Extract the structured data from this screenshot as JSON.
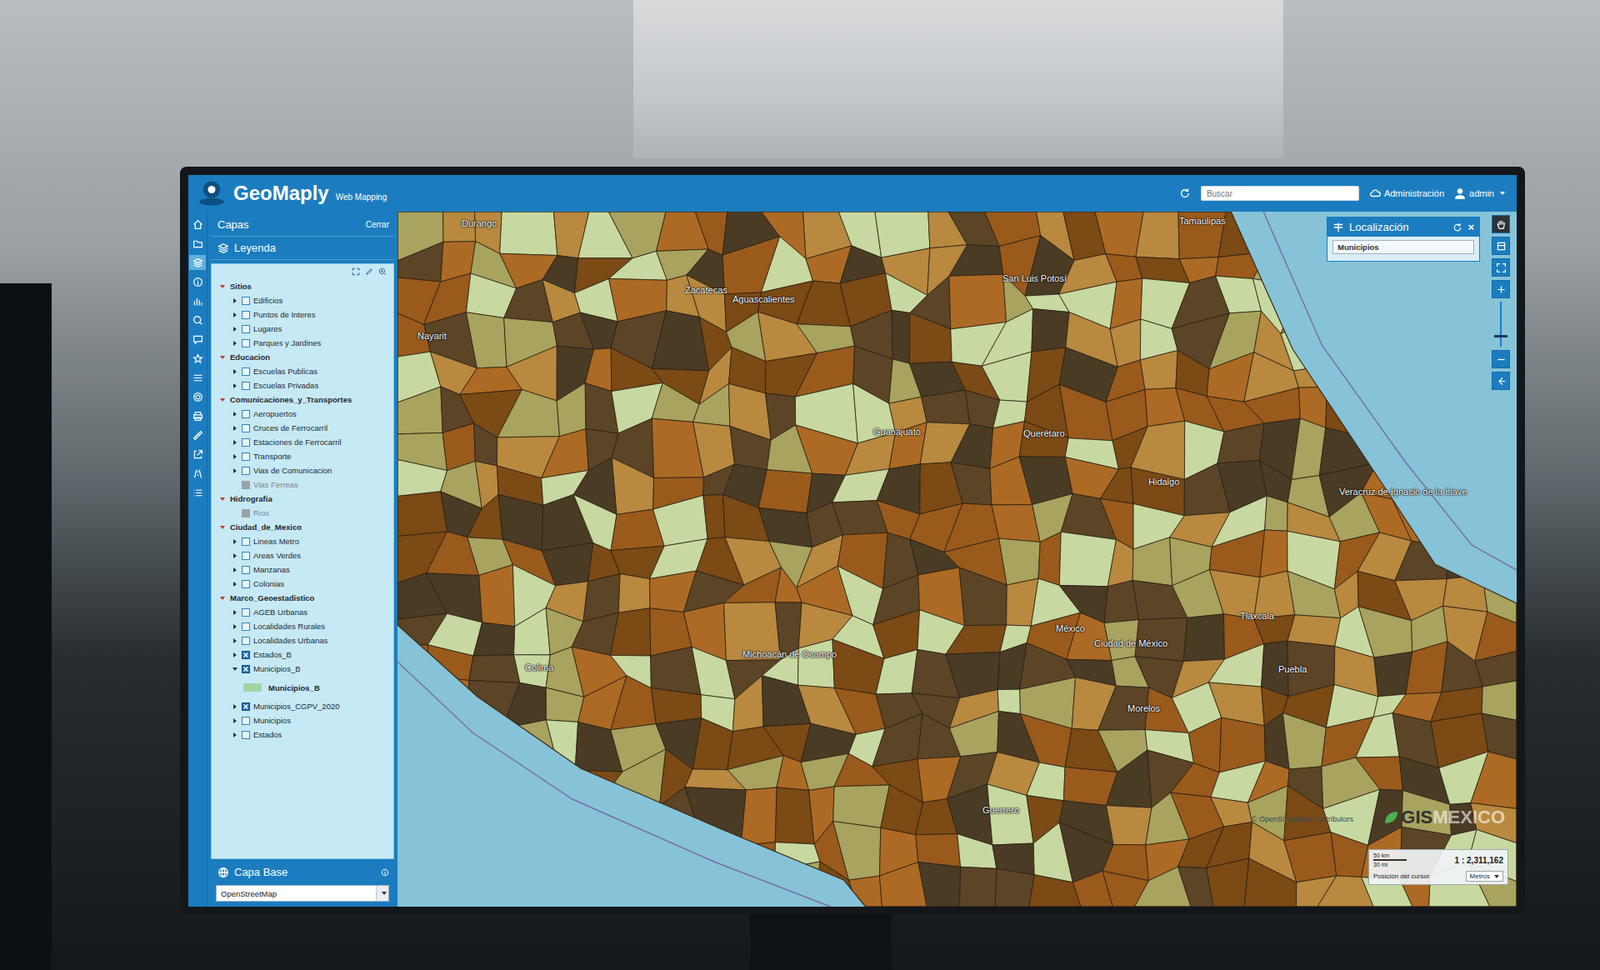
{
  "app": {
    "title": "GeoMaply",
    "subtitle": "Web Mapping"
  },
  "header": {
    "search_placeholder": "Buscar",
    "admin_link": "Administración",
    "user": "admin"
  },
  "rail": [
    {
      "selected": false
    },
    {
      "selected": false
    },
    {
      "selected": true
    },
    {
      "selected": false
    },
    {
      "selected": false
    },
    {
      "selected": false
    },
    {
      "selected": false
    },
    {
      "selected": false
    },
    {
      "selected": false
    },
    {
      "selected": false
    },
    {
      "selected": false
    },
    {
      "selected": false
    },
    {
      "selected": false
    },
    {
      "selected": false
    },
    {
      "selected": false
    }
  ],
  "sidebar": {
    "title": "Capas",
    "close": "Cerrar",
    "tab": "Leyenda",
    "groups": [
      {
        "label": "Sitios",
        "expanded": true,
        "items": [
          {
            "label": "Edificios",
            "checked": false,
            "expanded": false,
            "disabled": false
          },
          {
            "label": "Puntos de Interes",
            "checked": false,
            "expanded": false,
            "disabled": false
          },
          {
            "label": "Lugares",
            "checked": false,
            "expanded": false,
            "disabled": false
          },
          {
            "label": "Parques y Jardines",
            "checked": false,
            "expanded": false,
            "disabled": false
          }
        ]
      },
      {
        "label": "Educacion",
        "expanded": true,
        "items": [
          {
            "label": "Escuelas Publicas",
            "checked": false,
            "expanded": false,
            "disabled": false
          },
          {
            "label": "Escuelas Privadas",
            "checked": false,
            "expanded": false,
            "disabled": false
          }
        ]
      },
      {
        "label": "Comunicaciones_y_Transportes",
        "expanded": true,
        "items": [
          {
            "label": "Aeropuertos",
            "checked": false,
            "expanded": false,
            "disabled": false
          },
          {
            "label": "Cruces de Ferrocarril",
            "checked": false,
            "expanded": false,
            "disabled": false
          },
          {
            "label": "Estaciones de Ferrocarril",
            "checked": false,
            "expanded": false,
            "disabled": false
          },
          {
            "label": "Transporte",
            "checked": false,
            "expanded": false,
            "disabled": false
          },
          {
            "label": "Vias de Comunicacion",
            "checked": false,
            "expanded": false,
            "disabled": false
          },
          {
            "label": "Vias Ferreas",
            "checked": false,
            "expanded": false,
            "disabled": true
          }
        ]
      },
      {
        "label": "Hidrografia",
        "expanded": true,
        "items": [
          {
            "label": "Rios",
            "checked": false,
            "expanded": false,
            "disabled": true
          }
        ]
      },
      {
        "label": "Ciudad_de_Mexico",
        "expanded": true,
        "items": [
          {
            "label": "Lineas Metro",
            "checked": false,
            "expanded": false,
            "disabled": false
          },
          {
            "label": "Areas Verdes",
            "checked": false,
            "expanded": false,
            "disabled": false
          },
          {
            "label": "Manzanas",
            "checked": false,
            "expanded": false,
            "disabled": false
          },
          {
            "label": "Colonias",
            "checked": false,
            "expanded": false,
            "disabled": false
          }
        ]
      },
      {
        "label": "Marco_Geoestadistico",
        "expanded": true,
        "items": [
          {
            "label": "AGEB Urbanas",
            "checked": false,
            "expanded": false,
            "disabled": false
          },
          {
            "label": "Localidades Rurales",
            "checked": false,
            "expanded": false,
            "disabled": false
          },
          {
            "label": "Localidades Urbanas",
            "checked": false,
            "expanded": false,
            "disabled": false
          },
          {
            "label": "Estados_B",
            "checked": true,
            "expanded": false,
            "disabled": false
          },
          {
            "label": "Municipios_B",
            "checked": true,
            "expanded": true,
            "disabled": false,
            "legend": {
              "label": "Municipios_B",
              "color": "#9fd6a6"
            }
          },
          {
            "label": "Municipios_CGPV_2020",
            "checked": true,
            "expanded": false,
            "disabled": false
          },
          {
            "label": "Municipios",
            "checked": false,
            "expanded": false,
            "disabled": false
          },
          {
            "label": "Estados",
            "checked": false,
            "expanded": false,
            "disabled": false
          }
        ]
      }
    ]
  },
  "base_layer": {
    "title": "Capa Base",
    "value": "OpenStreetMap"
  },
  "localization": {
    "title": "Localización",
    "close": "×",
    "value": "Municipios"
  },
  "zoom": {
    "level": 0.2
  },
  "map": {
    "classes": [
      {
        "color": "#4a3b25"
      },
      {
        "color": "#5b4526"
      },
      {
        "color": "#7b4a15"
      },
      {
        "color": "#9a5a1c"
      },
      {
        "color": "#ad6a24"
      },
      {
        "color": "#b8893f"
      },
      {
        "color": "#a8a35e"
      },
      {
        "color": "#c7d9a0"
      }
    ],
    "labels": [
      "Durango",
      "Tamaulipas",
      "Zacatecas",
      "Aguascalientes",
      "San Luis Potosí",
      "Nayarit",
      "Guanajuato",
      "Querétaro",
      "Hidalgo",
      "Veracruz de Ignacio de la Llave",
      "Colima",
      "Michoacán de Ocampo",
      "México",
      "Ciudad de México",
      "Tlaxcala",
      "Puebla",
      "Morelos",
      "Guerrero"
    ]
  },
  "scale": {
    "metric": "50 km",
    "imperial": "30 mi",
    "ratio": "1 : 2,311,162",
    "cursor_label": "Posición del cursor",
    "units": "Metros"
  },
  "attribution": "© OpenStreetMap contributors",
  "watermark": {
    "prefix": "GIS",
    "suffix": "MEXICO"
  }
}
